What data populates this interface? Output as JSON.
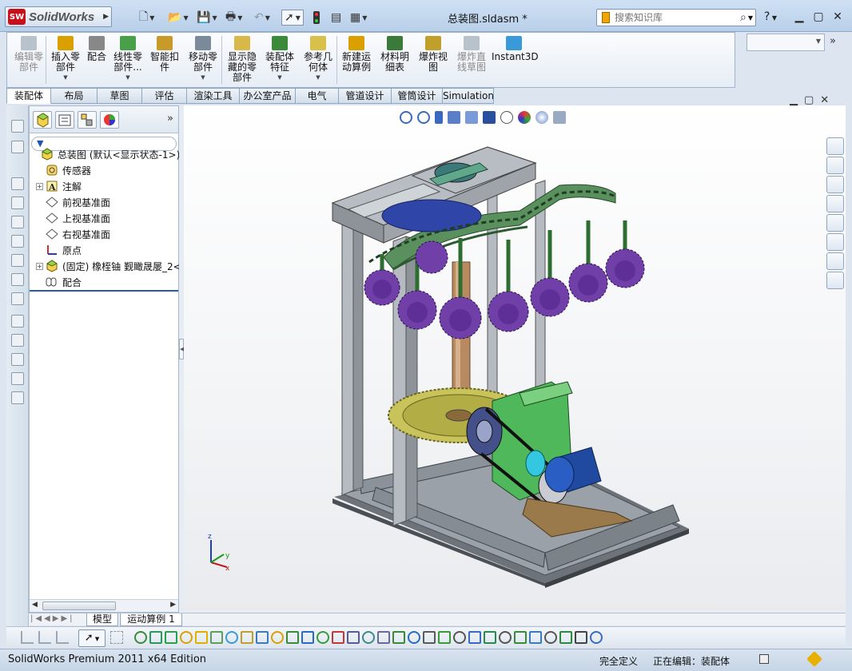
{
  "app": {
    "logo_text": "SolidWorks",
    "document_title": "总装图.sldasm *",
    "search_placeholder": "搜索知识库",
    "help_label": "?"
  },
  "command_manager": {
    "buttons": [
      {
        "label": "编辑零\n部件",
        "enabled": false
      },
      {
        "label": "插入零\n部件",
        "enabled": true
      },
      {
        "label": "配合",
        "enabled": true
      },
      {
        "label": "线性零\n部件...",
        "enabled": true
      },
      {
        "label": "智能扣\n件",
        "enabled": true
      },
      {
        "label": "移动零\n部件",
        "enabled": true
      },
      {
        "label": "显示隐\n藏的零\n部件",
        "enabled": true
      },
      {
        "label": "装配体\n特征",
        "enabled": true
      },
      {
        "label": "参考几\n何体",
        "enabled": true
      },
      {
        "label": "新建运\n动算例",
        "enabled": true
      },
      {
        "label": "材料明\n细表",
        "enabled": true
      },
      {
        "label": "爆炸视\n图",
        "enabled": true
      },
      {
        "label": "爆炸直\n线草图",
        "enabled": false
      },
      {
        "label": "Instant3D",
        "enabled": true
      }
    ]
  },
  "tabs": [
    "装配体",
    "布局",
    "草图",
    "评估",
    "渲染工具",
    "办公室产品",
    "电气",
    "管道设计",
    "管筒设计",
    "Simulation"
  ],
  "feature_tree": {
    "root": "总装图  (默认<显示状态-1>)",
    "items": [
      {
        "label": "传感器",
        "icon": "sensor-icon",
        "expandable": false
      },
      {
        "label": "注解",
        "icon": "annotation-icon",
        "expandable": true
      },
      {
        "label": "前视基准面",
        "icon": "plane-icon",
        "expandable": false
      },
      {
        "label": "上视基准面",
        "icon": "plane-icon",
        "expandable": false
      },
      {
        "label": "右视基准面",
        "icon": "plane-icon",
        "expandable": false
      },
      {
        "label": "原点",
        "icon": "origin-icon",
        "expandable": false
      },
      {
        "label": "(固定) 橡桎铀 觐瞰晟屡_2<",
        "icon": "part-icon",
        "expandable": true
      },
      {
        "label": "配合",
        "icon": "mates-icon",
        "expandable": false
      }
    ]
  },
  "bottom_tabs": [
    "模型",
    "运动算例 1"
  ],
  "status": {
    "edition": "SolidWorks Premium 2011 x64 Edition",
    "definition": "完全定义",
    "editing": "正在编辑：装配体"
  },
  "triad": {
    "x": "x",
    "y": "y",
    "z": "z"
  },
  "colors": {
    "accent": "#1a56b0",
    "frame_steel": "#a9aeb4",
    "gear_purple": "#7040a8",
    "motor_green": "#3fae4a",
    "worm_wheel": "#c8c35a"
  }
}
